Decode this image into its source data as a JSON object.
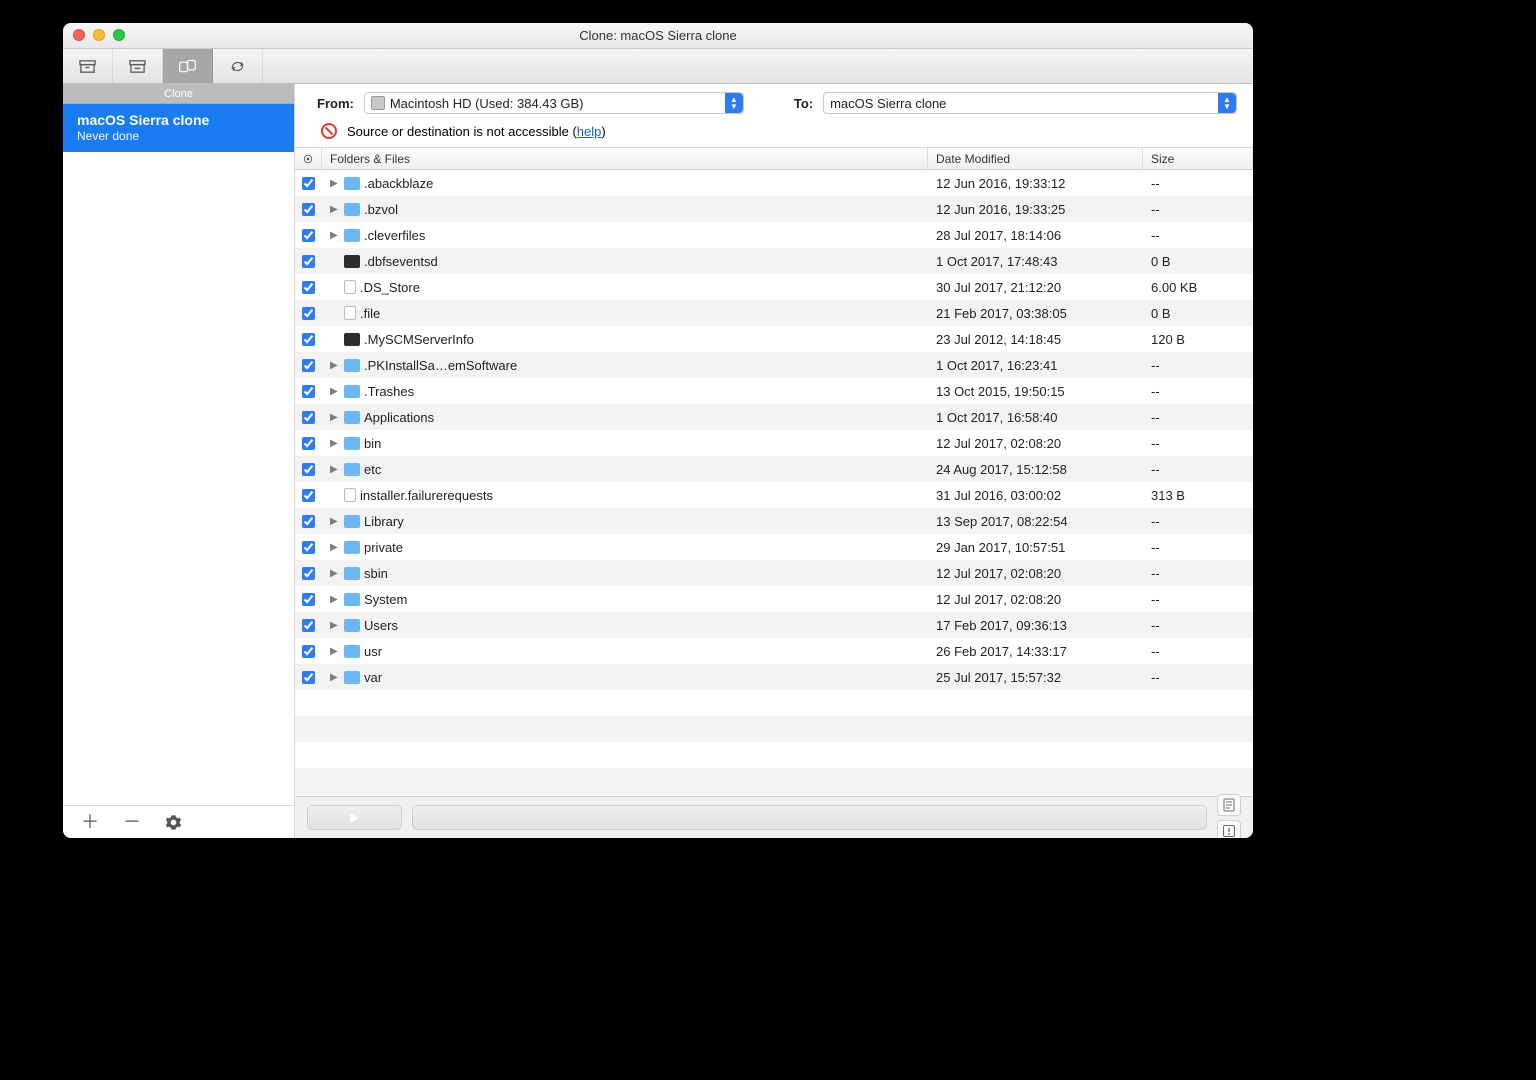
{
  "window": {
    "title": "Clone: macOS Sierra clone"
  },
  "toolbar": {
    "sub_label": "Clone"
  },
  "sidebar": {
    "item": {
      "title": "macOS Sierra clone",
      "subtitle": "Never done"
    }
  },
  "source": {
    "from_label": "From:",
    "from_value": "Macintosh HD (Used: 384.43 GB)",
    "to_label": "To:",
    "to_value": "macOS Sierra clone"
  },
  "warning": {
    "text_pre": "Source or destination is not accessible (",
    "link": "help",
    "text_post": ")"
  },
  "table": {
    "headers": {
      "name": "Folders & Files",
      "date": "Date Modified",
      "size": "Size"
    },
    "rows": [
      {
        "checked": true,
        "expandable": true,
        "icon": "folder",
        "name": ".abackblaze",
        "date": "12 Jun 2016, 19:33:12",
        "size": "--"
      },
      {
        "checked": true,
        "expandable": true,
        "icon": "folder",
        "name": ".bzvol",
        "date": "12 Jun 2016, 19:33:25",
        "size": "--"
      },
      {
        "checked": true,
        "expandable": true,
        "icon": "folder",
        "name": ".cleverfiles",
        "date": "28 Jul 2017, 18:14:06",
        "size": "--"
      },
      {
        "checked": true,
        "expandable": false,
        "icon": "dark",
        "name": ".dbfseventsd",
        "date": "1 Oct 2017, 17:48:43",
        "size": "0 B"
      },
      {
        "checked": true,
        "expandable": false,
        "icon": "file",
        "name": ".DS_Store",
        "date": "30 Jul 2017, 21:12:20",
        "size": "6.00 KB"
      },
      {
        "checked": true,
        "expandable": false,
        "icon": "file",
        "name": ".file",
        "date": "21 Feb 2017, 03:38:05",
        "size": "0 B"
      },
      {
        "checked": true,
        "expandable": false,
        "icon": "dark",
        "name": ".MySCMServerInfo",
        "date": "23 Jul 2012, 14:18:45",
        "size": "120 B"
      },
      {
        "checked": true,
        "expandable": true,
        "icon": "folder",
        "name": ".PKInstallSa…emSoftware",
        "date": "1 Oct 2017, 16:23:41",
        "size": "--"
      },
      {
        "checked": true,
        "expandable": true,
        "icon": "folder",
        "name": ".Trashes",
        "date": "13 Oct 2015, 19:50:15",
        "size": "--"
      },
      {
        "checked": true,
        "expandable": true,
        "icon": "folder",
        "name": "Applications",
        "date": "1 Oct 2017, 16:58:40",
        "size": "--"
      },
      {
        "checked": true,
        "expandable": true,
        "icon": "folder",
        "name": "bin",
        "date": "12 Jul 2017, 02:08:20",
        "size": "--"
      },
      {
        "checked": true,
        "expandable": true,
        "icon": "folder",
        "name": "etc",
        "date": "24 Aug 2017, 15:12:58",
        "size": "--"
      },
      {
        "checked": true,
        "expandable": false,
        "icon": "file",
        "name": "installer.failurerequests",
        "date": "31 Jul 2016, 03:00:02",
        "size": "313 B"
      },
      {
        "checked": true,
        "expandable": true,
        "icon": "folder",
        "name": "Library",
        "date": "13 Sep 2017, 08:22:54",
        "size": "--"
      },
      {
        "checked": true,
        "expandable": true,
        "icon": "folder",
        "name": "private",
        "date": "29 Jan 2017, 10:57:51",
        "size": "--"
      },
      {
        "checked": true,
        "expandable": true,
        "icon": "folder",
        "name": "sbin",
        "date": "12 Jul 2017, 02:08:20",
        "size": "--"
      },
      {
        "checked": true,
        "expandable": true,
        "icon": "folder",
        "name": "System",
        "date": "12 Jul 2017, 02:08:20",
        "size": "--"
      },
      {
        "checked": true,
        "expandable": true,
        "icon": "folder",
        "name": "Users",
        "date": "17 Feb 2017, 09:36:13",
        "size": "--"
      },
      {
        "checked": true,
        "expandable": true,
        "icon": "folder",
        "name": "usr",
        "date": "26 Feb 2017, 14:33:17",
        "size": "--"
      },
      {
        "checked": true,
        "expandable": true,
        "icon": "folder",
        "name": "var",
        "date": "25 Jul 2017, 15:57:32",
        "size": "--"
      }
    ]
  }
}
